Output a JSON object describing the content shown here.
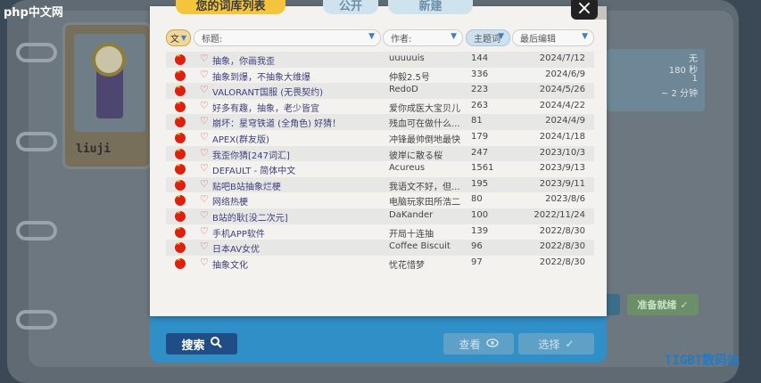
{
  "watermark": {
    "top_left": "php中文网",
    "bottom_right": "TIGBT数码站"
  },
  "tabs": {
    "title": "您的词库列表",
    "public": "公开",
    "new": "新建"
  },
  "close_label": "×",
  "filters": {
    "language": "文",
    "title_placeholder": "标题:",
    "author_placeholder": "作者:",
    "theme_placeholder": "主题词",
    "last_edit": "最后编辑"
  },
  "left_card": {
    "name": "liuji"
  },
  "right_panel": {
    "line1": "无",
    "line2": "180 秒",
    "line3": "1",
    "line4": "~ 2 分钟"
  },
  "right_button": "准备就绪",
  "bottom": {
    "search": "搜索",
    "view": "查看",
    "select": "选择"
  },
  "rows": [
    {
      "title": "抽象，你画我歪",
      "author": "uuuuuis",
      "count": "144",
      "date": "2024/7/12"
    },
    {
      "title": "抽象到爆，不抽象大维爆",
      "author": "仲毅2.5号",
      "count": "336",
      "date": "2024/6/9"
    },
    {
      "title": "VALORANT国服 (无畏契约)",
      "author": "RedoD",
      "count": "223",
      "date": "2024/5/26"
    },
    {
      "title": "好多有趣，抽象，老少皆宜",
      "author": "爱你成医大宝贝儿",
      "count": "263",
      "date": "2024/4/22"
    },
    {
      "title": "崩坏：星穹铁道 (全角色) 好猜！",
      "author": "残血可在做什么...",
      "count": "81",
      "date": "2024/4/9"
    },
    {
      "title": "APEX(群友版)",
      "author": "冲锋最帅倒地最快",
      "count": "179",
      "date": "2024/1/18"
    },
    {
      "title": "我歪你猜[247词汇]",
      "author": "彼岸に散る桜",
      "count": "247",
      "date": "2023/10/3"
    },
    {
      "title": "DEFAULT - 简体中文",
      "author": "Acureus",
      "count": "1561",
      "date": "2023/9/13"
    },
    {
      "title": "贴吧B站抽象烂梗",
      "author": "我语文不好，但...",
      "count": "195",
      "date": "2023/9/11"
    },
    {
      "title": "网络热梗",
      "author": "电脑玩家田所浩二",
      "count": "80",
      "date": "2023/8/6"
    },
    {
      "title": "B站的耿[没二次元]",
      "author": "DaKander",
      "count": "100",
      "date": "2022/11/24"
    },
    {
      "title": "手机APP软件",
      "author": "开局十连抽",
      "count": "139",
      "date": "2022/8/30"
    },
    {
      "title": "日本AV女优",
      "author": "Coffee Biscuit",
      "count": "96",
      "date": "2022/8/30"
    },
    {
      "title": "抽象文化",
      "author": "忧花惜梦",
      "count": "97",
      "date": "2022/8/30"
    }
  ]
}
